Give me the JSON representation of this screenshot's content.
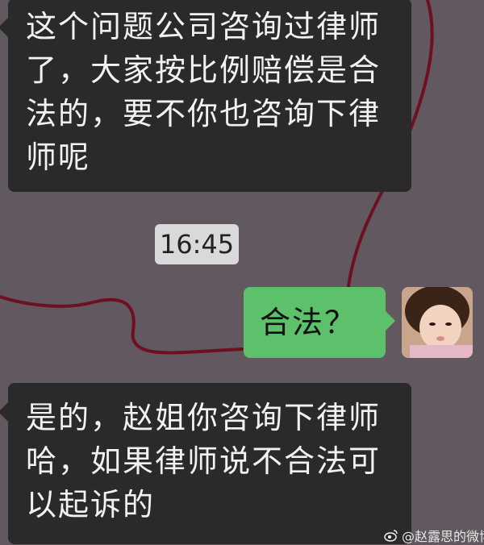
{
  "messages": [
    {
      "side": "incoming",
      "text": "这个问题公司咨询过律师了，大家按比例赔偿是合法的，要不你也咨询下律师呢"
    },
    {
      "side": "outgoing",
      "text": "合法？"
    },
    {
      "side": "incoming",
      "text": "是的，赵姐你咨询下律师哈，如果律师说不合法可以起诉的"
    }
  ],
  "timestamp": "16:45",
  "watermark": "@赵露思的微博",
  "colors": {
    "background": "#615860",
    "incoming_bubble": "#2a2a2a",
    "outgoing_bubble": "#5dc16c",
    "timestamp_bg": "#d9d9d9",
    "doodle_line": "#6e1020"
  }
}
